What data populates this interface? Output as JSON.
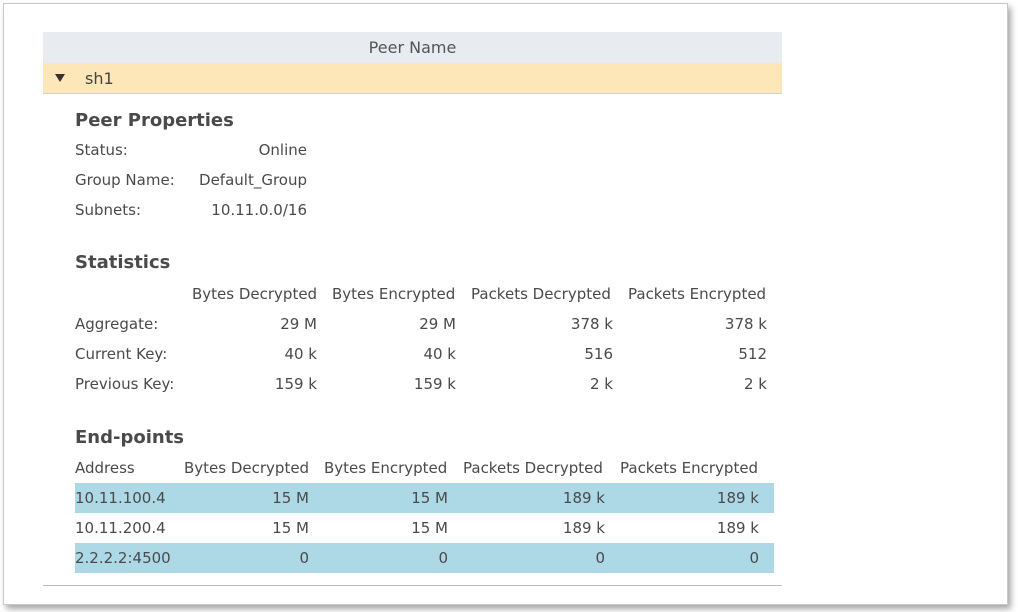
{
  "table": {
    "column_header": "Peer Name"
  },
  "peer": {
    "name": "sh1"
  },
  "properties": {
    "title": "Peer Properties",
    "status_label": "Status:",
    "status_value": "Online",
    "group_label": "Group Name:",
    "group_value": "Default_Group",
    "subnets_label": "Subnets:",
    "subnets_value": "10.11.0.0/16"
  },
  "statistics": {
    "title": "Statistics",
    "columns": [
      "Bytes Decrypted",
      "Bytes Encrypted",
      "Packets Decrypted",
      "Packets Encrypted"
    ],
    "rows": [
      {
        "label": "Aggregate:",
        "values": [
          "29 M",
          "29 M",
          "378 k",
          "378 k"
        ]
      },
      {
        "label": "Current Key:",
        "values": [
          "40 k",
          "40 k",
          "516",
          "512"
        ]
      },
      {
        "label": "Previous Key:",
        "values": [
          "159 k",
          "159 k",
          "2 k",
          "2 k"
        ]
      }
    ]
  },
  "endpoints": {
    "title": "End-points",
    "columns": [
      "Address",
      "Bytes Decrypted",
      "Bytes Encrypted",
      "Packets Decrypted",
      "Packets Encrypted"
    ],
    "rows": [
      {
        "address": "10.11.100.4",
        "values": [
          "15 M",
          "15 M",
          "189 k",
          "189 k"
        ],
        "highlighted": true
      },
      {
        "address": "10.11.200.4",
        "values": [
          "15 M",
          "15 M",
          "189 k",
          "189 k"
        ],
        "highlighted": false
      },
      {
        "address": "2.2.2.2:4500",
        "values": [
          "0",
          "0",
          "0",
          "0"
        ],
        "highlighted": true
      }
    ]
  },
  "colors": {
    "header_bg": "#e8ebef",
    "selected_peer_bg": "#fde6b8",
    "row_highlight": "#add8e6"
  }
}
